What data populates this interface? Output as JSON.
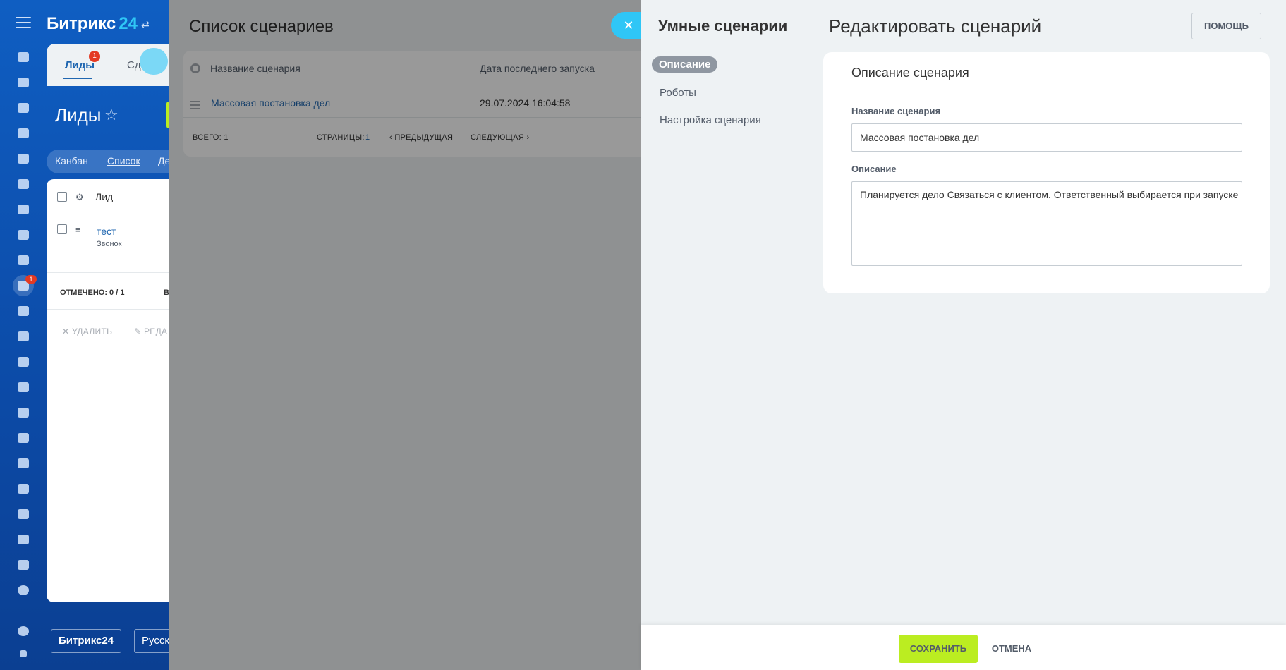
{
  "app": {
    "logo_name": "Битрикс",
    "logo_number": "24",
    "crm_tabs": [
      "Лиды",
      "Сд"
    ],
    "leads_badge": "1",
    "rail_badge": "1",
    "page_title": "Лиды",
    "views": [
      "Канбан",
      "Список",
      "Де"
    ],
    "grid": {
      "column_header": "Лид",
      "row_title": "тест",
      "row_subtitle": "Звонок",
      "selected_counter": "ОТМЕЧЕНО: 0 / 1",
      "counter_suffix": "ВС",
      "action_delete": "УДАЛИТЬ",
      "action_edit": "РЕДА"
    },
    "bottom_logo_button": "Битрикс24",
    "bottom_lang_button": "Русск"
  },
  "scenario_list": {
    "title": "Список сценариев",
    "columns": [
      "Название сценария",
      "Дата последнего запуска"
    ],
    "rows": [
      {
        "name": "Массовая постановка дел",
        "last_run": "29.07.2024 16:04:58"
      }
    ],
    "footer": {
      "total": "ВСЕГО: 1",
      "pages_label": "СТРАНИЦЫ:",
      "page_number": "1",
      "prev": "ПРЕДЫДУЩАЯ",
      "next": "СЛЕДУЮЩАЯ"
    }
  },
  "editor": {
    "sidebar_title": "Умные сценарии",
    "nav": [
      "Описание",
      "Роботы",
      "Настройка сценария"
    ],
    "title": "Редактировать сценарий",
    "help_button": "ПОМОЩЬ",
    "section_heading": "Описание сценария",
    "name_label": "Название сценария",
    "name_value": "Массовая постановка дел",
    "description_label": "Описание",
    "description_value": "Планируется дело Связаться с клиентом. Ответственный выбирается при запуске",
    "save_button": "СОХРАНИТЬ",
    "cancel_button": "ОТМЕНА",
    "close_icon": "close-icon"
  },
  "colors": {
    "accent_blue": "#2fc6f6",
    "save_green": "#bbed21",
    "link": "#2067b0",
    "badge_red": "#e43a23"
  }
}
